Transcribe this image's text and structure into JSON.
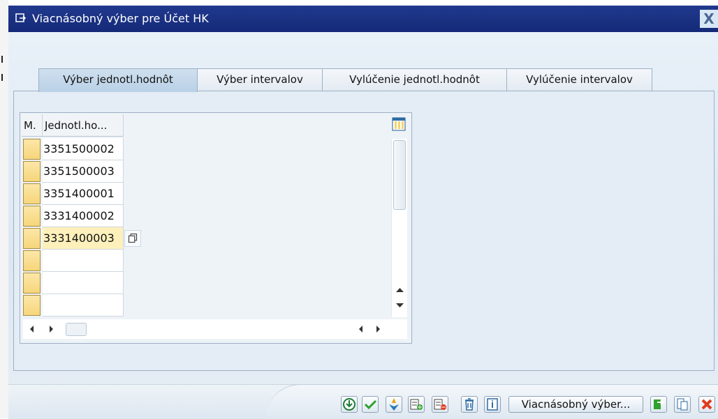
{
  "window": {
    "title": "Viacnásobný výber pre Účet HK",
    "close_symbol": "X"
  },
  "tabs": [
    {
      "label": "Výber jednotl.hodnôt",
      "active": true
    },
    {
      "label": "Výber intervalov",
      "active": false
    },
    {
      "label": "Vylúčenie jednotl.hodnôt",
      "active": false
    },
    {
      "label": "Vylúčenie intervalov",
      "active": false
    }
  ],
  "table": {
    "columns": [
      "M.",
      "Jednotl.ho..."
    ],
    "rows": [
      "3351500002",
      "3351500003",
      "3351400001",
      "3331400002",
      "3331400003",
      "",
      "",
      ""
    ],
    "current_row": 5
  },
  "footer": {
    "multiple_selection_button": "Viacnásobný výber..."
  },
  "icons": {
    "title": "window-open-icon",
    "column_settings": "column-settings-icon",
    "cell_copy": "copy-value-icon",
    "toolbar": [
      "execute-icon",
      "accept-icon",
      "check-icon",
      "insert-line-icon",
      "delete-line-icon",
      "delete-all-icon",
      "information-icon",
      "import-icon",
      "clipboard-icon",
      "cancel-icon"
    ]
  },
  "colors": {
    "title_bar": "#142A78",
    "selection_yellow": "#F6D67B",
    "active_tab": "#B9D0E6",
    "accept_green": "#2FA12C",
    "cancel_red": "#E23A1D"
  }
}
